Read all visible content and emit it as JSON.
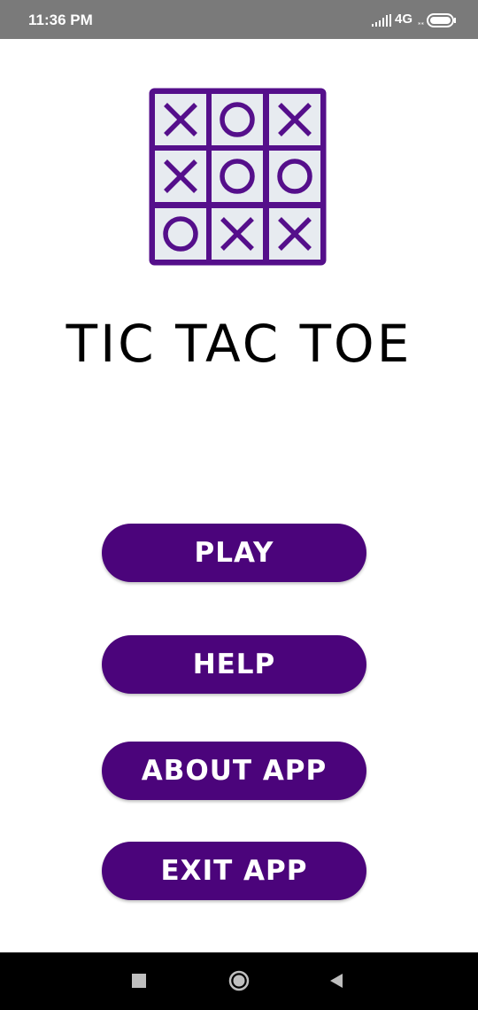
{
  "status_bar": {
    "time": "11:36 PM",
    "network": "4G",
    "network_sub": "⁎⁎",
    "icons": [
      "signal-icon",
      "battery-icon"
    ]
  },
  "app": {
    "title": "TIC TAC TOE",
    "logo_grid": [
      [
        "X",
        "O",
        "X"
      ],
      [
        "X",
        "O",
        "O"
      ],
      [
        "O",
        "X",
        "X"
      ]
    ],
    "buttons": {
      "play": "PLAY",
      "help": "HELP",
      "about": "ABOUT APP",
      "exit": "EXIT APP"
    }
  },
  "nav_bar": {
    "icons": [
      "recents-icon",
      "home-icon",
      "back-icon"
    ]
  },
  "colors": {
    "primary": "#4b047b",
    "logo_cell": "#e7ebf0",
    "logo_border": "#550f8b",
    "status_bar": "#7a7a7a"
  }
}
